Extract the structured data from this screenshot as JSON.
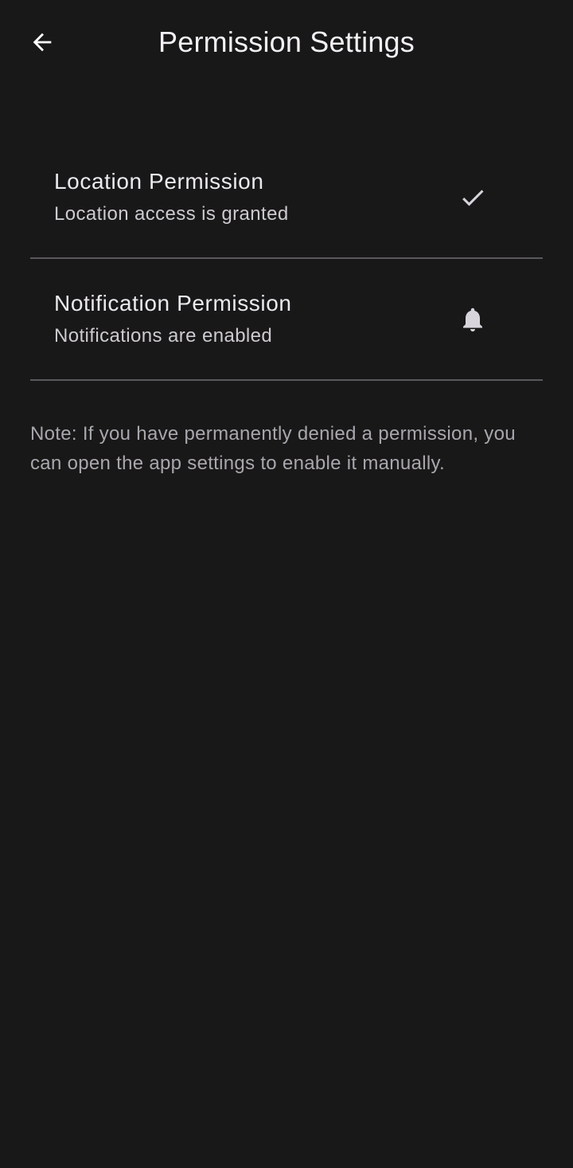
{
  "app_bar": {
    "title": "Permission Settings",
    "back_icon": "arrow-back-icon"
  },
  "permissions": [
    {
      "title": "Location Permission",
      "status": "Location access is granted",
      "icon": "check-icon"
    },
    {
      "title": "Notification Permission",
      "status": "Notifications are enabled",
      "icon": "bell-icon"
    }
  ],
  "note": "Note: If you have permanently denied a permission, you can open the app settings to enable it manually.",
  "colors": {
    "background": "#181818",
    "divider": "#5a585c",
    "icon": "#d8d4dc"
  }
}
